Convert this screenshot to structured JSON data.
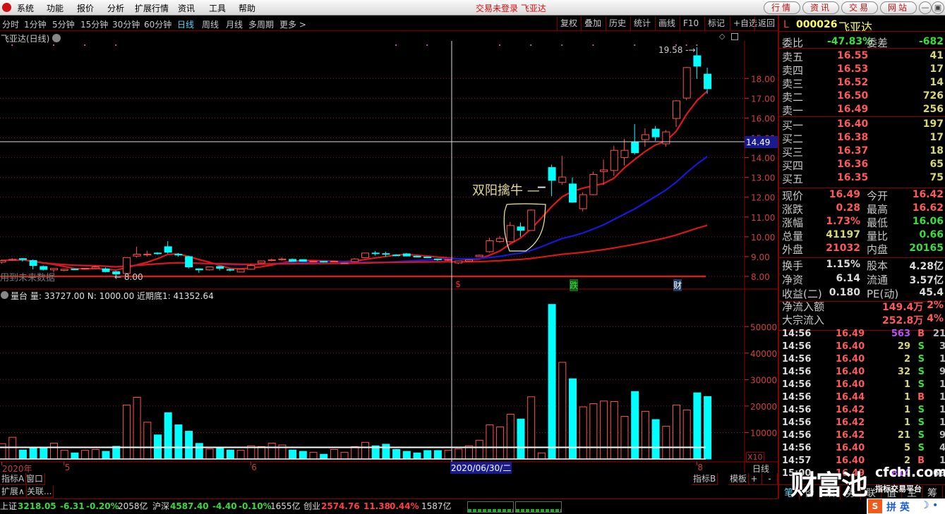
{
  "menu": {
    "items": [
      "系统",
      "功能",
      "报价",
      "分析",
      "扩展行情",
      "资讯",
      "工具",
      "帮助"
    ],
    "title": "交易未登录 飞亚达",
    "right_buttons": [
      "行情",
      "资讯",
      "交易",
      "网站"
    ],
    "window_buttons": [
      "minimize-icon",
      "restore-icon"
    ]
  },
  "toolbar": {
    "periods": [
      "分时",
      "1分钟",
      "5分钟",
      "15分钟",
      "30分钟",
      "60分钟",
      "日线",
      "周线",
      "月线",
      "多周期",
      "更多 >"
    ],
    "active_period": "日线",
    "right_buttons": [
      "复权",
      "叠加",
      "历史",
      "统计",
      "画线",
      "F10",
      "标记",
      "+自选",
      "返回"
    ]
  },
  "chart": {
    "title": "飞亚达(日线)",
    "annotation": "双阳擒牛 —",
    "future_data_text": "用到未来数据",
    "low_marker": "← 8.00",
    "high_marker": "19.58 -→",
    "crosshair_price": "14.49",
    "crosshair_date": "2020/06/30/二",
    "event_markers": [
      {
        "label": "$",
        "bar": 44,
        "color": "#ff3030"
      },
      {
        "label": "跌",
        "bar": 55,
        "color": "#3ade3a",
        "bg": "#1a5a1a"
      },
      {
        "label": "财",
        "bar": 65,
        "color": "#ffffff",
        "bg": "#203a60"
      }
    ],
    "volume_header": "量台 量: 33727.00 N: 1000.00 近期底1: 41352.64",
    "volume_scale_label": "X10",
    "date_labels": [
      {
        "label": "2020年",
        "bar": 0
      },
      {
        "label": "5",
        "bar": 6
      },
      {
        "label": "6",
        "bar": 24
      },
      {
        "label": "8",
        "bar": 67
      }
    ],
    "axis_period": "日线"
  },
  "chart_data": {
    "type": "candlestick",
    "price_ylim": [
      8,
      19.9
    ],
    "price_ticks": [
      "8.00",
      "9.00",
      "10.00",
      "11.00",
      "12.00",
      "13.00",
      "14.00",
      "15.00",
      "16.00",
      "17.00",
      "18.00"
    ],
    "volume_ylim": [
      0,
      60000
    ],
    "volume_ticks": [
      "10000",
      "20000",
      "30000",
      "40000",
      "50000"
    ],
    "volume_reference_line": 4400,
    "support_line": 8.0,
    "ma_periods": [
      5,
      20,
      60
    ],
    "colors": {
      "up": "#ff5050",
      "down": "#00ffff",
      "ma1": "#e01818",
      "ma2": "#1818d8",
      "ma3": "#d81818"
    },
    "top_markers": [
      1,
      5,
      8,
      11,
      38,
      41,
      48,
      51,
      54,
      57,
      61,
      65,
      66,
      67
    ],
    "ohlc": [
      [
        8.72,
        8.85,
        8.65,
        8.8
      ],
      [
        8.82,
        8.92,
        8.78,
        8.86
      ],
      [
        8.9,
        8.92,
        8.75,
        8.85
      ],
      [
        8.8,
        8.85,
        8.35,
        8.55
      ],
      [
        8.5,
        8.55,
        8.3,
        8.35
      ],
      [
        8.33,
        8.42,
        8.2,
        8.4
      ],
      [
        8.3,
        8.38,
        8.26,
        8.36
      ],
      [
        8.37,
        8.4,
        8.32,
        8.34
      ],
      [
        8.4,
        8.42,
        8.38,
        8.41
      ],
      [
        8.4,
        8.55,
        8.36,
        8.48
      ],
      [
        8.38,
        8.45,
        8.2,
        8.24
      ],
      [
        8.24,
        8.28,
        8.0,
        8.12
      ],
      [
        8.15,
        8.95,
        8.1,
        8.95
      ],
      [
        9.03,
        9.5,
        8.95,
        9.12
      ],
      [
        9.08,
        9.3,
        9.0,
        9.12
      ],
      [
        9.18,
        9.22,
        9.1,
        9.15
      ],
      [
        9.5,
        9.78,
        9.15,
        9.22
      ],
      [
        9.12,
        9.18,
        9.0,
        9.08
      ],
      [
        9.0,
        9.05,
        8.4,
        8.48
      ],
      [
        8.38,
        8.4,
        8.18,
        8.33
      ],
      [
        8.33,
        8.5,
        8.3,
        8.48
      ],
      [
        8.5,
        8.52,
        8.3,
        8.41
      ],
      [
        8.35,
        8.4,
        8.25,
        8.32
      ],
      [
        8.22,
        8.38,
        8.2,
        8.36
      ],
      [
        8.36,
        8.62,
        8.33,
        8.55
      ],
      [
        8.68,
        8.8,
        8.66,
        8.78
      ],
      [
        8.8,
        8.9,
        8.76,
        8.84
      ],
      [
        8.84,
        8.95,
        8.8,
        8.88
      ],
      [
        8.86,
        8.9,
        8.74,
        8.76
      ],
      [
        8.85,
        8.86,
        8.74,
        8.76
      ],
      [
        8.74,
        8.78,
        8.72,
        8.77
      ],
      [
        8.76,
        8.78,
        8.7,
        8.75
      ],
      [
        8.74,
        8.8,
        8.72,
        8.77
      ],
      [
        8.67,
        8.7,
        8.62,
        8.68
      ],
      [
        8.75,
        8.92,
        8.72,
        8.88
      ],
      [
        8.95,
        9.2,
        8.92,
        9.18
      ],
      [
        9.18,
        9.28,
        9.05,
        9.16
      ],
      [
        9.15,
        9.25,
        9.0,
        9.12
      ],
      [
        9.08,
        9.12,
        9.02,
        9.06
      ],
      [
        9.14,
        9.18,
        9.02,
        9.03
      ],
      [
        9.02,
        9.05,
        8.96,
        8.98
      ],
      [
        8.98,
        9.0,
        8.92,
        8.96
      ],
      [
        8.88,
        8.9,
        8.78,
        8.85
      ],
      [
        8.82,
        8.88,
        8.78,
        8.85
      ],
      [
        8.68,
        8.8,
        8.62,
        8.78
      ],
      [
        8.76,
        8.86,
        8.74,
        8.84
      ],
      [
        9.0,
        9.1,
        8.98,
        9.07
      ],
      [
        9.25,
        9.96,
        9.2,
        9.8
      ],
      [
        9.76,
        10.05,
        9.7,
        9.92
      ],
      [
        9.75,
        10.75,
        9.7,
        10.57
      ],
      [
        10.5,
        10.72,
        10.0,
        10.33
      ],
      [
        10.32,
        11.38,
        10.3,
        11.35
      ],
      [
        12.52,
        12.52,
        12.52,
        12.52
      ],
      [
        13.5,
        13.65,
        12.05,
        12.85
      ],
      [
        12.75,
        14.1,
        12.62,
        13.02
      ],
      [
        12.67,
        13.0,
        11.72,
        11.75
      ],
      [
        11.42,
        12.25,
        11.28,
        12.13
      ],
      [
        12.13,
        13.3,
        12.1,
        13.15
      ],
      [
        13.3,
        13.9,
        12.62,
        13.38
      ],
      [
        13.35,
        14.6,
        13.08,
        14.37
      ],
      [
        14.0,
        14.95,
        13.6,
        14.37
      ],
      [
        14.8,
        15.7,
        14.15,
        14.25
      ],
      [
        14.91,
        15.48,
        14.55,
        15.16
      ],
      [
        15.44,
        15.6,
        14.85,
        15.05
      ],
      [
        14.7,
        15.4,
        14.55,
        15.3
      ],
      [
        15.98,
        16.9,
        15.55,
        16.87
      ],
      [
        17.01,
        18.58,
        16.9,
        18.55
      ],
      [
        19.15,
        19.58,
        17.98,
        18.62
      ],
      [
        18.22,
        18.55,
        17.23,
        17.48
      ]
    ],
    "volume": [
      5800,
      8200,
      3400,
      4000,
      4000,
      6000,
      3300,
      2300,
      3300,
      3600,
      2900,
      4800,
      20400,
      23300,
      13900,
      9100,
      17500,
      12900,
      10500,
      5900,
      3800,
      4000,
      3400,
      3300,
      5000,
      4700,
      6000,
      5300,
      3400,
      2900,
      2500,
      1800,
      3600,
      2500,
      4700,
      6300,
      5000,
      5600,
      3600,
      2900,
      2300,
      3200,
      3200,
      3300,
      3800,
      5000,
      7100,
      12900,
      12100,
      16900,
      15100,
      23500,
      2300,
      58400,
      36500,
      30300,
      19700,
      20900,
      21900,
      21700,
      16100,
      25500,
      18000,
      14900,
      12400,
      20400,
      18500,
      25000,
      23600
    ]
  },
  "quote": {
    "market": "L",
    "code": "000026",
    "name": "飞亚达",
    "weibi_label": "委比",
    "weibi": "-47.83%",
    "weicha_label": "委差",
    "weicha": "-682",
    "asks": [
      {
        "label": "卖五",
        "price": "16.55",
        "vol": "41"
      },
      {
        "label": "卖四",
        "price": "16.53",
        "vol": "17"
      },
      {
        "label": "卖三",
        "price": "16.52",
        "vol": "14"
      },
      {
        "label": "卖二",
        "price": "16.50",
        "vol": "726"
      },
      {
        "label": "卖一",
        "price": "16.49",
        "vol": "256"
      }
    ],
    "bids": [
      {
        "label": "买一",
        "price": "16.40",
        "vol": "197"
      },
      {
        "label": "买二",
        "price": "16.38",
        "vol": "17"
      },
      {
        "label": "买三",
        "price": "16.37",
        "vol": "18"
      },
      {
        "label": "买四",
        "price": "16.36",
        "vol": "65"
      },
      {
        "label": "买五",
        "price": "16.35",
        "vol": "75"
      }
    ],
    "stats": [
      {
        "l1": "现价",
        "v1": "16.49",
        "c1": "red",
        "l2": "今开",
        "v2": "16.42",
        "c2": "red"
      },
      {
        "l1": "涨跌",
        "v1": "0.28",
        "c1": "red",
        "l2": "最高",
        "v2": "16.62",
        "c2": "red"
      },
      {
        "l1": "涨幅",
        "v1": "1.73%",
        "c1": "red",
        "l2": "最低",
        "v2": "16.06",
        "c2": "green"
      },
      {
        "l1": "总量",
        "v1": "41197",
        "c1": "yellow",
        "l2": "量比",
        "v2": "0.66",
        "c2": "green"
      },
      {
        "l1": "外盘",
        "v1": "21032",
        "c1": "red",
        "l2": "内盘",
        "v2": "20165",
        "c2": "green"
      }
    ],
    "fundamentals": [
      {
        "l1": "换手",
        "v1": "1.15%",
        "l2": "股本",
        "v2": "4.28亿"
      },
      {
        "l1": "净资",
        "v1": "6.14",
        "l2": "流通",
        "v2": "3.57亿"
      },
      {
        "l1": "收益(二)",
        "v1": "0.180",
        "l2": "PE(动)",
        "v2": "45.4"
      }
    ],
    "flows": [
      {
        "label": "净流入额",
        "value": "149.4万",
        "pct": "2%"
      },
      {
        "label": "大宗流入",
        "value": "252.8万",
        "pct": "4%"
      }
    ],
    "trades": [
      {
        "t": "14:56",
        "p": "16.49",
        "v": "563",
        "d": "B",
        "n": "21",
        "vc": "purple"
      },
      {
        "t": "14:56",
        "p": "16.40",
        "v": "29",
        "d": "S",
        "n": "3"
      },
      {
        "t": "14:56",
        "p": "16.40",
        "v": "2",
        "d": "S",
        "n": "1"
      },
      {
        "t": "14:56",
        "p": "16.40",
        "v": "32",
        "d": "S",
        "n": "9"
      },
      {
        "t": "14:56",
        "p": "16.40",
        "v": "1",
        "d": "S",
        "n": "1"
      },
      {
        "t": "14:56",
        "p": "16.44",
        "v": "1",
        "d": "B",
        "n": "1"
      },
      {
        "t": "14:56",
        "p": "16.42",
        "v": "1",
        "d": "S",
        "n": "1"
      },
      {
        "t": "14:56",
        "p": "16.42",
        "v": "1",
        "d": "S",
        "n": "1"
      },
      {
        "t": "14:56",
        "p": "16.42",
        "v": "21",
        "d": "S",
        "n": "9"
      },
      {
        "t": "14:56",
        "p": "16.40",
        "v": "5",
        "d": "S",
        "n": "4"
      },
      {
        "t": "14:57",
        "p": "16.40",
        "v": "2",
        "d": "B",
        "n": "1"
      },
      {
        "t": "15:00",
        "p": "16.49",
        "v": "814",
        "d": "",
        "n": "69",
        "vc": "purple"
      }
    ],
    "tabs": [
      "笔",
      "价",
      "细",
      "势",
      "联",
      "值",
      "主",
      "筹"
    ]
  },
  "bottom_tabs": {
    "row1": [
      "指标A",
      "窗口"
    ],
    "row2": [
      "扩展∧",
      "关联..."
    ],
    "right": [
      "指标B",
      "模板",
      "+",
      "-"
    ]
  },
  "status": {
    "items": [
      {
        "name": "上证",
        "price": "3218.05",
        "chg": "-6.31",
        "pct": "-0.20%",
        "amt": "2058亿",
        "c": "green"
      },
      {
        "name": "沪深",
        "price": "4587.40",
        "chg": "-4.40",
        "pct": "-0.10%",
        "amt": "1655亿",
        "c": "green"
      },
      {
        "name": "创业",
        "price": "2574.76",
        "chg": "11.38",
        "pct": "0.44%",
        "amt": "1587亿",
        "c": "red"
      }
    ]
  },
  "watermark": {
    "logo": "财富池",
    "site": "cfchi.com",
    "slogan": "指标交易平台"
  },
  "ime": {
    "label": "拼 英"
  }
}
